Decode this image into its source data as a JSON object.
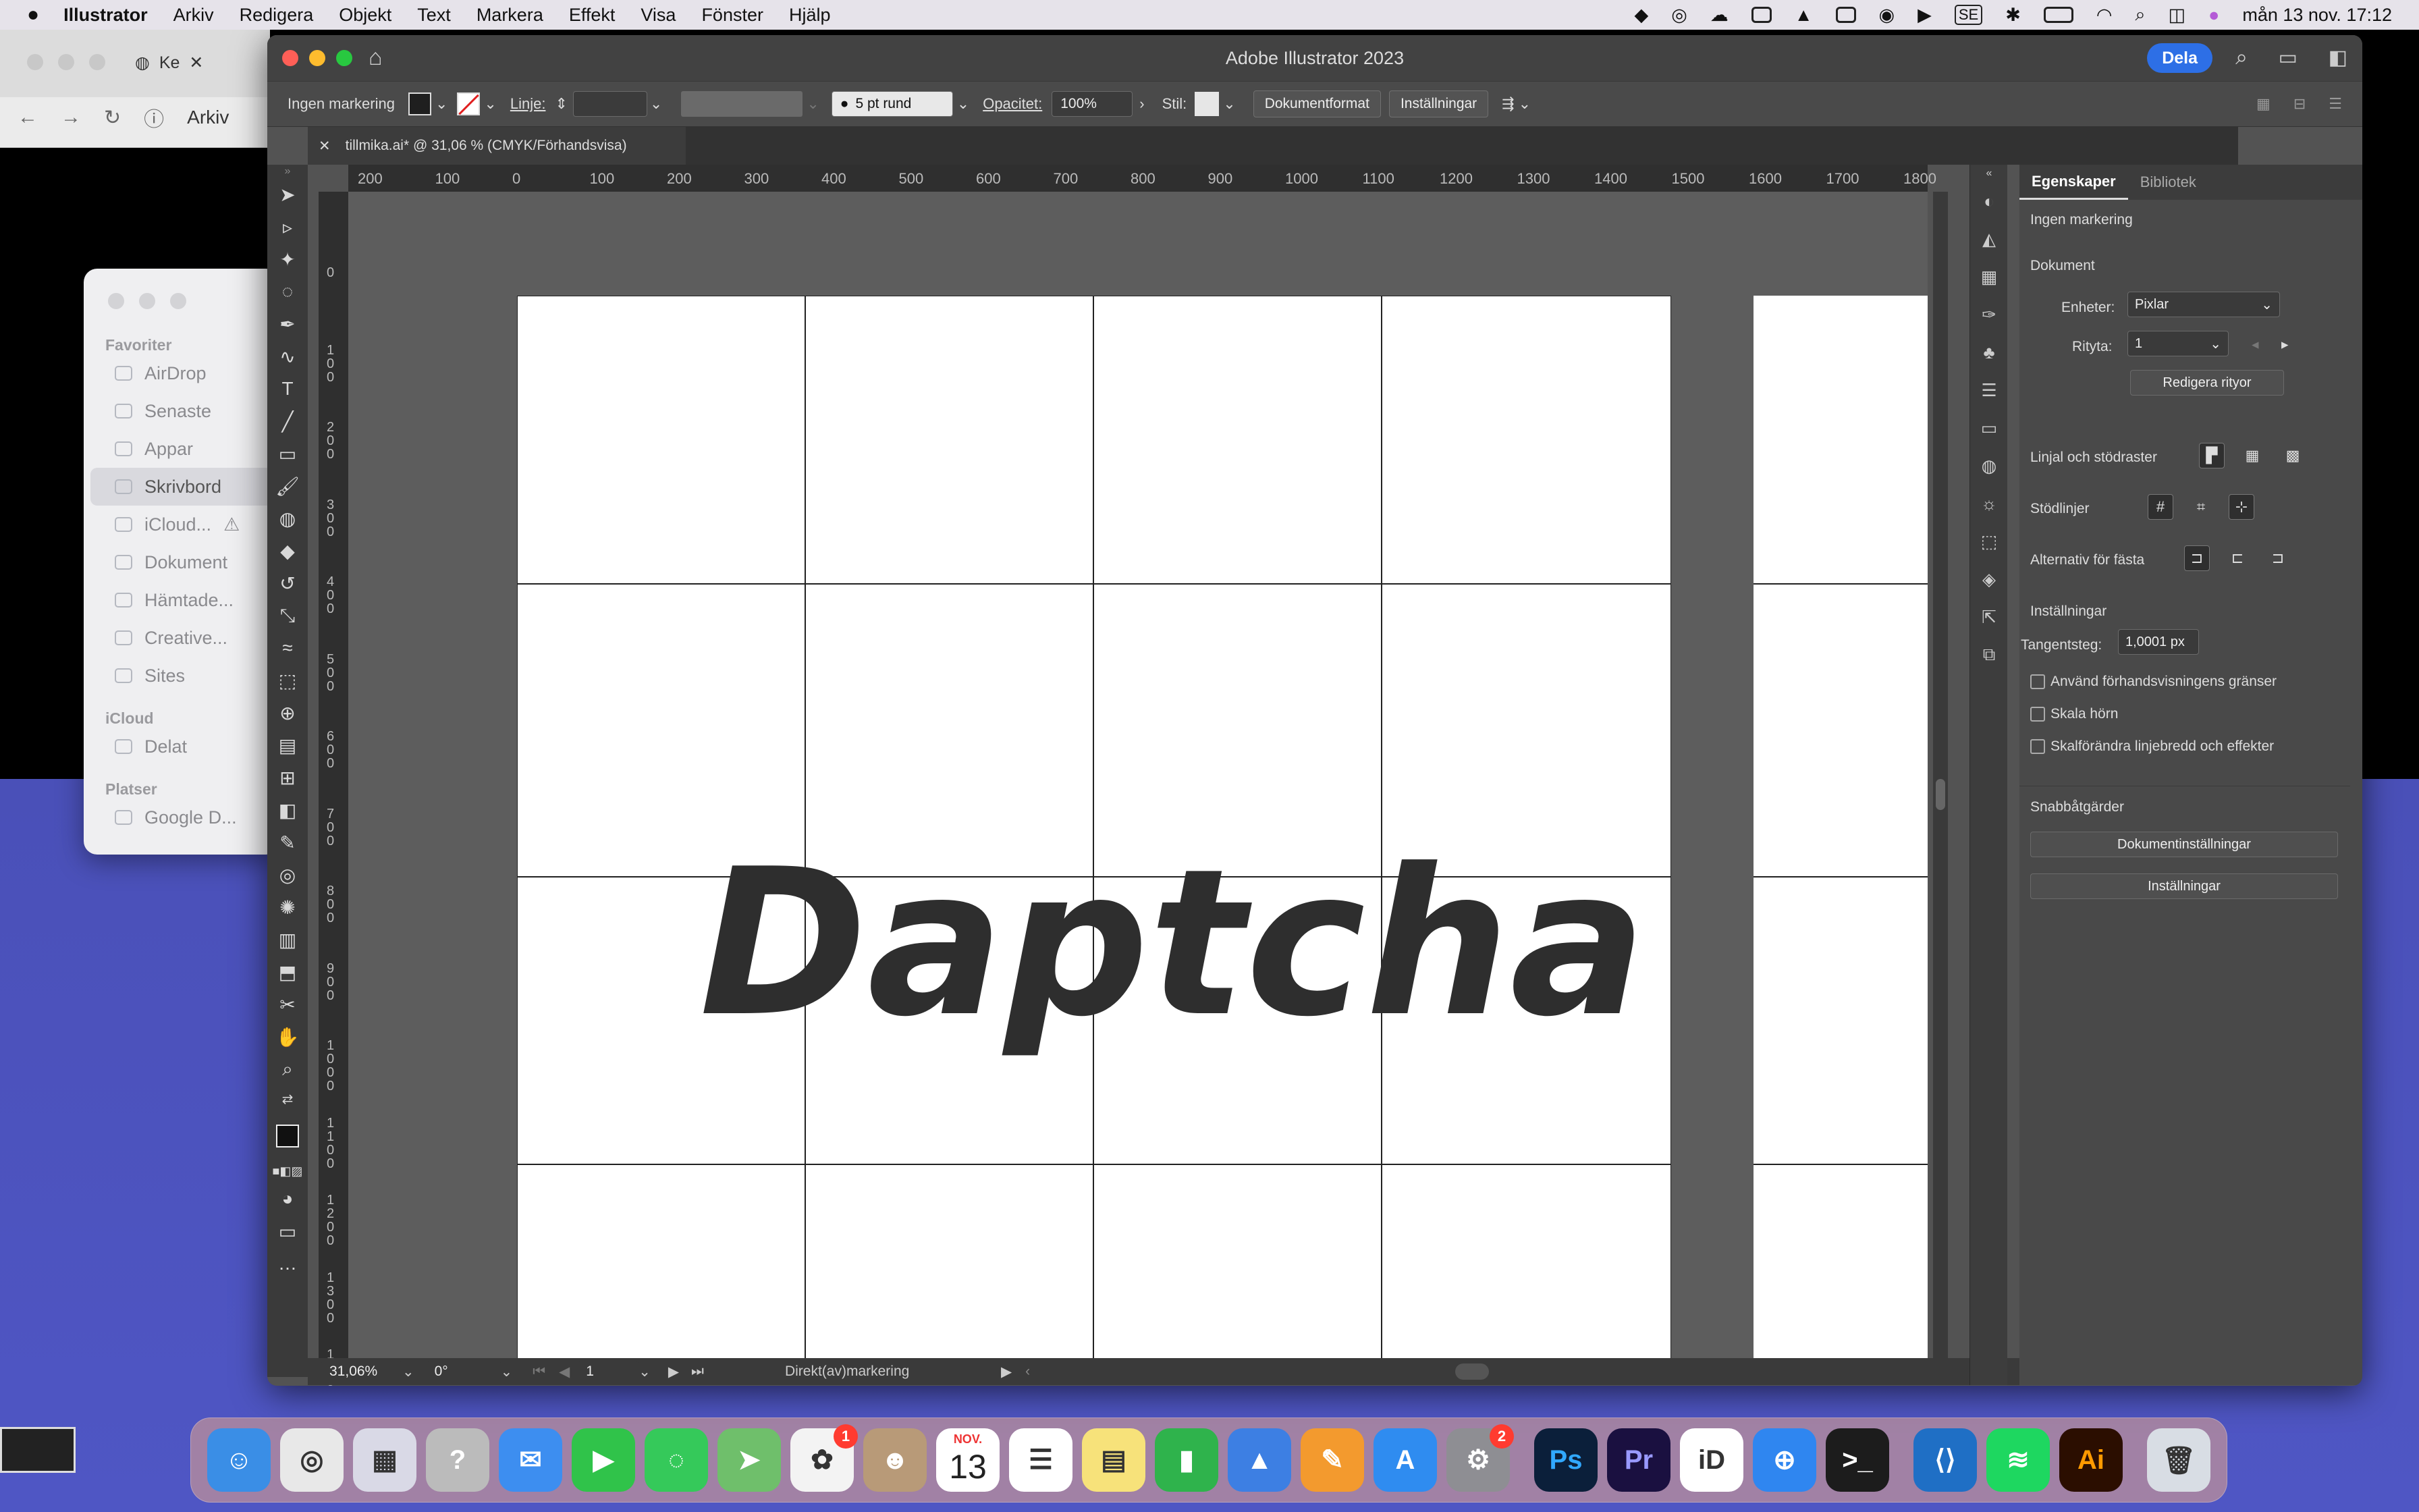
{
  "menubar": {
    "app": "Illustrator",
    "items": [
      "Arkiv",
      "Redigera",
      "Objekt",
      "Text",
      "Markera",
      "Effekt",
      "Visa",
      "Fönster",
      "Hjälp"
    ],
    "keyboard": "SE",
    "datetime": "mån 13 nov. 17:12"
  },
  "browser": {
    "tab_label": "Ke",
    "menu_label": "Arkiv"
  },
  "finder": {
    "favorites_label": "Favoriter",
    "favorites": [
      "AirDrop",
      "Senaste",
      "Appar",
      "Skrivbord",
      "iCloud...",
      "Dokument",
      "Hämtade...",
      "Creative...",
      "Sites"
    ],
    "icloud_label": "iCloud",
    "icloud": [
      "Delat"
    ],
    "places_label": "Platser",
    "places": [
      "Google D..."
    ]
  },
  "ai": {
    "title": "Adobe Illustrator 2023",
    "share": "Dela",
    "control": {
      "selection": "Ingen markering",
      "stroke_label": "Linje:",
      "brush": "5 pt rund",
      "opacity_label": "Opacitet:",
      "opacity": "100%",
      "style_label": "Stil:",
      "doc_format": "Dokumentformat",
      "settings": "Inställningar"
    },
    "tab": "tillmika.ai* @ 31,06 % (CMYK/Förhandsvisa)",
    "hruler": [
      "200",
      "100",
      "0",
      "100",
      "200",
      "300",
      "400",
      "500",
      "600",
      "700",
      "800",
      "900",
      "1000",
      "1100",
      "1200",
      "1300",
      "1400",
      "1500",
      "1600",
      "1700",
      "1800"
    ],
    "vruler": [
      "0",
      "100",
      "200",
      "300",
      "400",
      "500",
      "600",
      "700",
      "800",
      "900",
      "1000",
      "1100",
      "1200",
      "1300",
      "1400"
    ],
    "artwork_text": "Daptcha",
    "status": {
      "zoom": "31,06%",
      "rotation": "0°",
      "artboard": "1",
      "tool": "Direkt(av)markering"
    },
    "props": {
      "tab_active": "Egenskaper",
      "tab_other": "Bibliotek",
      "no_selection": "Ingen markering",
      "document": "Dokument",
      "units_label": "Enheter:",
      "units_value": "Pixlar",
      "artboard_label": "Rityta:",
      "artboard_value": "1",
      "edit_artboards": "Redigera rityor",
      "rulers_grids": "Linjal och stödraster",
      "guides": "Stödlinjer",
      "snap": "Alternativ för fästa",
      "preferences": "Inställningar",
      "keyboard_inc_label": "Tangentsteg:",
      "keyboard_inc_value": "1,0001 px",
      "cb1": "Använd förhandsvisningens gränser",
      "cb2": "Skala hörn",
      "cb3": "Skalförändra linjebredd och effekter",
      "quick_actions": "Snabbåtgärder",
      "doc_settings": "Dokumentinställningar",
      "settings_btn": "Inställningar"
    }
  },
  "dock": {
    "apps": [
      {
        "name": "Finder",
        "color": "#3a8ee6",
        "glyph": "☺"
      },
      {
        "name": "Chrome",
        "color": "#e8e8e8",
        "glyph": "◎"
      },
      {
        "name": "Launchpad",
        "color": "#d9d9e6",
        "glyph": "▦"
      },
      {
        "name": "Help",
        "color": "#bbbbbb",
        "glyph": "?"
      },
      {
        "name": "Mail",
        "color": "#3d8ef0",
        "glyph": "✉"
      },
      {
        "name": "FaceTime",
        "color": "#30c34a",
        "glyph": "▶"
      },
      {
        "name": "Messages",
        "color": "#35c95a",
        "glyph": "◌"
      },
      {
        "name": "Maps",
        "color": "#6fbf6b",
        "glyph": "➤"
      },
      {
        "name": "Photos",
        "color": "#f3f3f3",
        "glyph": "✿"
      },
      {
        "name": "Contacts",
        "color": "#b89a78",
        "glyph": "☻"
      },
      {
        "name": "Calendar",
        "color": "#ffffff",
        "glyph": "13"
      },
      {
        "name": "Reminders",
        "color": "#ffffff",
        "glyph": "☰"
      },
      {
        "name": "Notes",
        "color": "#f7e27a",
        "glyph": "▤"
      },
      {
        "name": "Numbers",
        "color": "#2fb34c",
        "glyph": "▮"
      },
      {
        "name": "Keynote",
        "color": "#3d7fe3",
        "glyph": "▲"
      },
      {
        "name": "Pages",
        "color": "#f39a2e",
        "glyph": "✎"
      },
      {
        "name": "App Store",
        "color": "#2f8cf0",
        "glyph": "A"
      },
      {
        "name": "System Settings",
        "color": "#8e8e93",
        "glyph": "⚙"
      },
      {
        "name": "Photoshop",
        "color": "#0b1f3a",
        "glyph": "Ps"
      },
      {
        "name": "Premiere",
        "color": "#1a1040",
        "glyph": "Pr"
      },
      {
        "name": "BankID",
        "color": "#ffffff",
        "glyph": "iD"
      },
      {
        "name": "Safari",
        "color": "#2f86f0",
        "glyph": "⊕"
      },
      {
        "name": "Terminal",
        "color": "#1c1c1c",
        "glyph": ">_"
      },
      {
        "name": "VS Code",
        "color": "#1f6fc5",
        "glyph": "⟨⟩"
      },
      {
        "name": "Spotify",
        "color": "#1ed760",
        "glyph": "≋"
      },
      {
        "name": "Illustrator",
        "color": "#2b0e00",
        "glyph": "Ai"
      },
      {
        "name": "Trash",
        "color": "#d8dde4",
        "glyph": "🗑"
      }
    ],
    "calendar_month": "NOV.",
    "calendar_day": "13",
    "photos_badge": "1",
    "settings_badge": "2"
  }
}
